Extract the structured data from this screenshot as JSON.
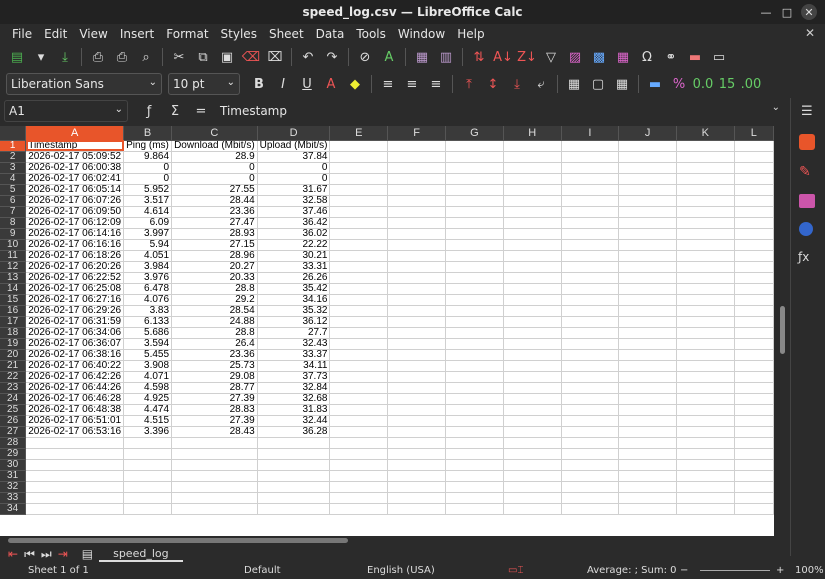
{
  "window": {
    "title": "speed_log.csv — LibreOffice Calc"
  },
  "menu": [
    "File",
    "Edit",
    "View",
    "Insert",
    "Format",
    "Styles",
    "Sheet",
    "Data",
    "Tools",
    "Window",
    "Help"
  ],
  "format": {
    "font_name": "Liberation Sans",
    "font_size": "10 pt"
  },
  "formula": {
    "cell_ref": "A1",
    "content": "Timestamp"
  },
  "columns": [
    "A",
    "B",
    "C",
    "D",
    "E",
    "F",
    "G",
    "H",
    "I",
    "J",
    "K",
    "L"
  ],
  "rows": [
    [
      "Timestamp",
      "Ping (ms)",
      "Download (Mbit/s)",
      "Upload (Mbit/s)"
    ],
    [
      "2026-02-17 05:09:52",
      "9.864",
      "28.9",
      "37.84"
    ],
    [
      "2026-02-17 06:00:38",
      "0",
      "0",
      "0"
    ],
    [
      "2026-02-17 06:02:41",
      "0",
      "0",
      "0"
    ],
    [
      "2026-02-17 06:05:14",
      "5.952",
      "27.55",
      "31.67"
    ],
    [
      "2026-02-17 06:07:26",
      "3.517",
      "28.44",
      "32.58"
    ],
    [
      "2026-02-17 06:09:50",
      "4.614",
      "23.36",
      "37.46"
    ],
    [
      "2026-02-17 06:12:09",
      "6.09",
      "27.47",
      "36.42"
    ],
    [
      "2026-02-17 06:14:16",
      "3.997",
      "28.93",
      "36.02"
    ],
    [
      "2026-02-17 06:16:16",
      "5.94",
      "27.15",
      "22.22"
    ],
    [
      "2026-02-17 06:18:26",
      "4.051",
      "28.96",
      "30.21"
    ],
    [
      "2026-02-17 06:20:26",
      "3.984",
      "20.27",
      "33.31"
    ],
    [
      "2026-02-17 06:22:52",
      "3.976",
      "20.33",
      "26.26"
    ],
    [
      "2026-02-17 06:25:08",
      "6.478",
      "28.8",
      "35.42"
    ],
    [
      "2026-02-17 06:27:16",
      "4.076",
      "29.2",
      "34.16"
    ],
    [
      "2026-02-17 06:29:26",
      "3.83",
      "28.54",
      "35.32"
    ],
    [
      "2026-02-17 06:31:59",
      "6.133",
      "24.88",
      "36.12"
    ],
    [
      "2026-02-17 06:34:06",
      "5.686",
      "28.8",
      "27.7"
    ],
    [
      "2026-02-17 06:36:07",
      "3.594",
      "26.4",
      "32.43"
    ],
    [
      "2026-02-17 06:38:16",
      "5.455",
      "23.36",
      "33.37"
    ],
    [
      "2026-02-17 06:40:22",
      "3.908",
      "25.73",
      "34.11"
    ],
    [
      "2026-02-17 06:42:26",
      "4.071",
      "29.08",
      "37.73"
    ],
    [
      "2026-02-17 06:44:26",
      "4.598",
      "28.77",
      "32.84"
    ],
    [
      "2026-02-17 06:46:28",
      "4.925",
      "27.39",
      "32.68"
    ],
    [
      "2026-02-17 06:48:38",
      "4.474",
      "28.83",
      "31.83"
    ],
    [
      "2026-02-17 06:51:01",
      "4.515",
      "27.39",
      "32.44"
    ],
    [
      "2026-02-17 06:53:16",
      "3.396",
      "28.43",
      "36.28"
    ]
  ],
  "empty_rows": [
    "28",
    "29",
    "30",
    "31",
    "32",
    "33",
    "34"
  ],
  "sheet_tab": "speed_log",
  "status": {
    "sheet": "Sheet 1 of 1",
    "style": "Default",
    "language": "English (USA)",
    "summary": "Average: ; Sum: 0",
    "zoom": "100%"
  }
}
